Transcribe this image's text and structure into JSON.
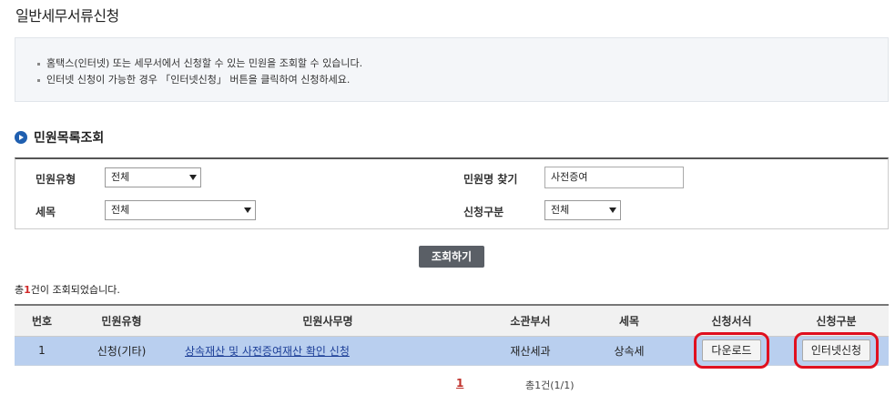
{
  "page": {
    "title": "일반세무서류신청"
  },
  "info": {
    "lines": [
      "홈택스(인터넷) 또는 세무서에서 신청할 수 있는 민원을 조회할 수 있습니다.",
      "인터넷 신청이 가능한 경우 「인터넷신청」 버튼을 클릭하여 신청하세요."
    ]
  },
  "section": {
    "title": "민원목록조회"
  },
  "search": {
    "type_label": "민원유형",
    "type_value": "전체",
    "name_label": "민원명 찾기",
    "name_value": "사전증여",
    "tax_label": "세목",
    "tax_value": "전체",
    "apply_label": "신청구분",
    "apply_value": "전체",
    "button": "조회하기"
  },
  "result": {
    "prefix": "총",
    "count": "1",
    "suffix": "건이 조회되었습니다."
  },
  "table": {
    "headers": [
      "번호",
      "민원유형",
      "민원사무명",
      "소관부서",
      "세목",
      "신청서식",
      "신청구분"
    ],
    "rows": [
      {
        "no": "1",
        "type": "신청(기타)",
        "name": "상속재산 및 사전증여재산 확인 신청",
        "dept": "재산세과",
        "tax": "상속세",
        "form": "다운로드",
        "apply": "인터넷신청"
      }
    ]
  },
  "pager": {
    "current": "1",
    "total": "총1건(1/1)"
  },
  "colors": {
    "accent": "#1f5fb0",
    "row_highlight": "#b9cfef",
    "annotation": "#e0101f"
  }
}
